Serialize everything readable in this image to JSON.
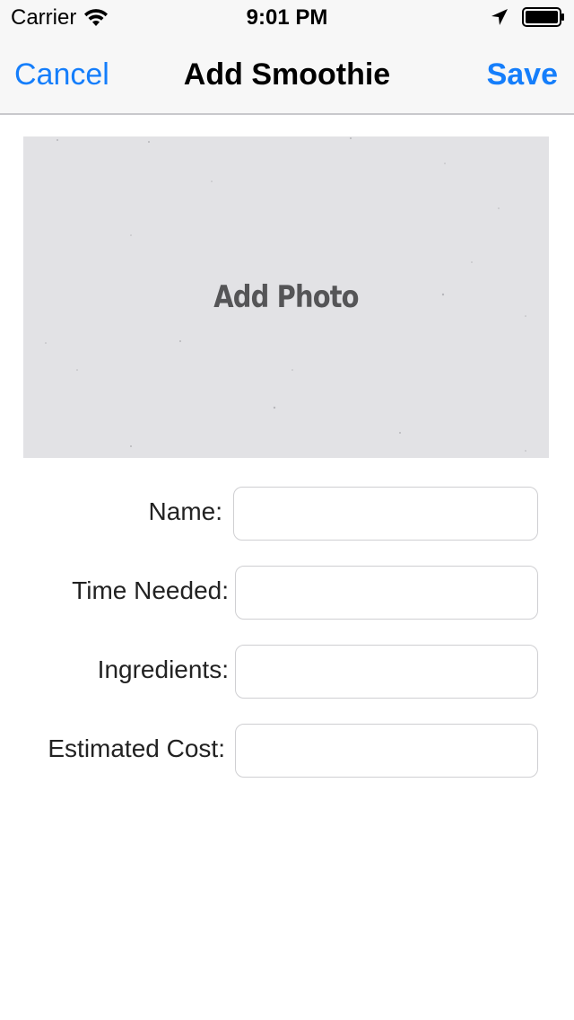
{
  "status_bar": {
    "carrier": "Carrier",
    "time": "9:01 PM",
    "icons": [
      "wifi-icon",
      "location-arrow-icon",
      "battery-icon"
    ]
  },
  "nav": {
    "cancel_label": "Cancel",
    "title": "Add Smoothie",
    "save_label": "Save"
  },
  "photo": {
    "label": "Add Photo"
  },
  "form": {
    "fields": [
      {
        "label": "Name:",
        "value": "",
        "placeholder": ""
      },
      {
        "label": "Time Needed:",
        "value": "",
        "placeholder": ""
      },
      {
        "label": "Ingredients:",
        "value": "",
        "placeholder": ""
      },
      {
        "label": "Estimated Cost:",
        "value": "",
        "placeholder": ""
      }
    ]
  },
  "colors": {
    "accent": "#157efb",
    "nav_background": "#f7f7f7",
    "photo_background": "#e2e2e5"
  }
}
